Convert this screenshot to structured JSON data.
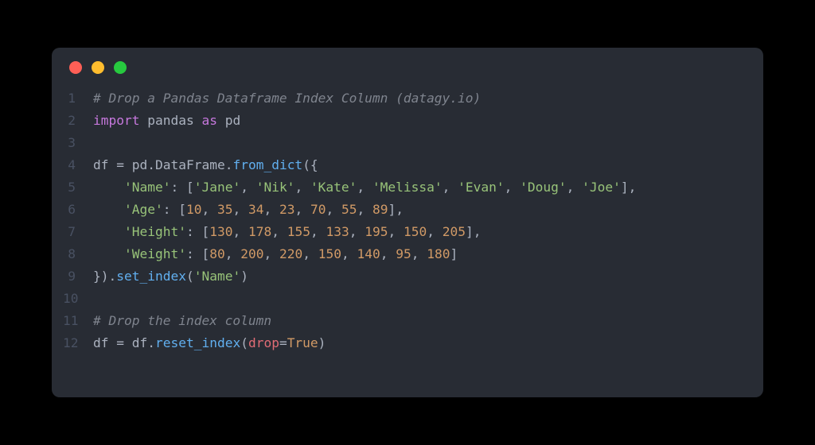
{
  "window": {
    "dots": [
      "red",
      "yellow",
      "green"
    ]
  },
  "lines": {
    "l1_comment": "# Drop a Pandas Dataframe Index Column (datagy.io)",
    "l2_import": "import",
    "l2_module": "pandas",
    "l2_as": "as",
    "l2_alias": "pd",
    "l4_var": "df",
    "l4_eq": " = ",
    "l4_pd": "pd",
    "l4_dot1": ".",
    "l4_df": "DataFrame",
    "l4_dot2": ".",
    "l4_from": "from_dict",
    "l4_open": "({",
    "l5_key": "'Name'",
    "l5_colon": ": [",
    "l5_s1": "'Jane'",
    "l5_s2": "'Nik'",
    "l5_s3": "'Kate'",
    "l5_s4": "'Melissa'",
    "l5_s5": "'Evan'",
    "l5_s6": "'Doug'",
    "l5_s7": "'Joe'",
    "l5_sep": ", ",
    "l5_close": "],",
    "l6_key": "'Age'",
    "l6_colon": ": [",
    "l6_n1": "10",
    "l6_n2": "35",
    "l6_n3": "34",
    "l6_n4": "23",
    "l6_n5": "70",
    "l6_n6": "55",
    "l6_n7": "89",
    "l6_close": "],",
    "l7_key": "'Height'",
    "l7_colon": ": [",
    "l7_n1": "130",
    "l7_n2": "178",
    "l7_n3": "155",
    "l7_n4": "133",
    "l7_n5": "195",
    "l7_n6": "150",
    "l7_n7": "205",
    "l7_close": "],",
    "l8_key": "'Weight'",
    "l8_colon": ": [",
    "l8_n1": "80",
    "l8_n2": "200",
    "l8_n3": "220",
    "l8_n4": "150",
    "l8_n5": "140",
    "l8_n6": "95",
    "l8_n7": "180",
    "l8_close": "]",
    "l9_close": "}).",
    "l9_setindex": "set_index",
    "l9_open": "(",
    "l9_arg": "'Name'",
    "l9_cparen": ")",
    "l11_comment": "# Drop the index column",
    "l12_var": "df",
    "l12_eq": " = ",
    "l12_df2": "df",
    "l12_dot": ".",
    "l12_reset": "reset_index",
    "l12_open": "(",
    "l12_param": "drop",
    "l12_assign": "=",
    "l12_true": "True",
    "l12_close": ")"
  },
  "linenums": {
    "n1": "1",
    "n2": "2",
    "n3": "3",
    "n4": "4",
    "n5": "5",
    "n6": "6",
    "n7": "7",
    "n8": "8",
    "n9": "9",
    "n10": "10",
    "n11": "11",
    "n12": "12"
  },
  "sep": ", "
}
